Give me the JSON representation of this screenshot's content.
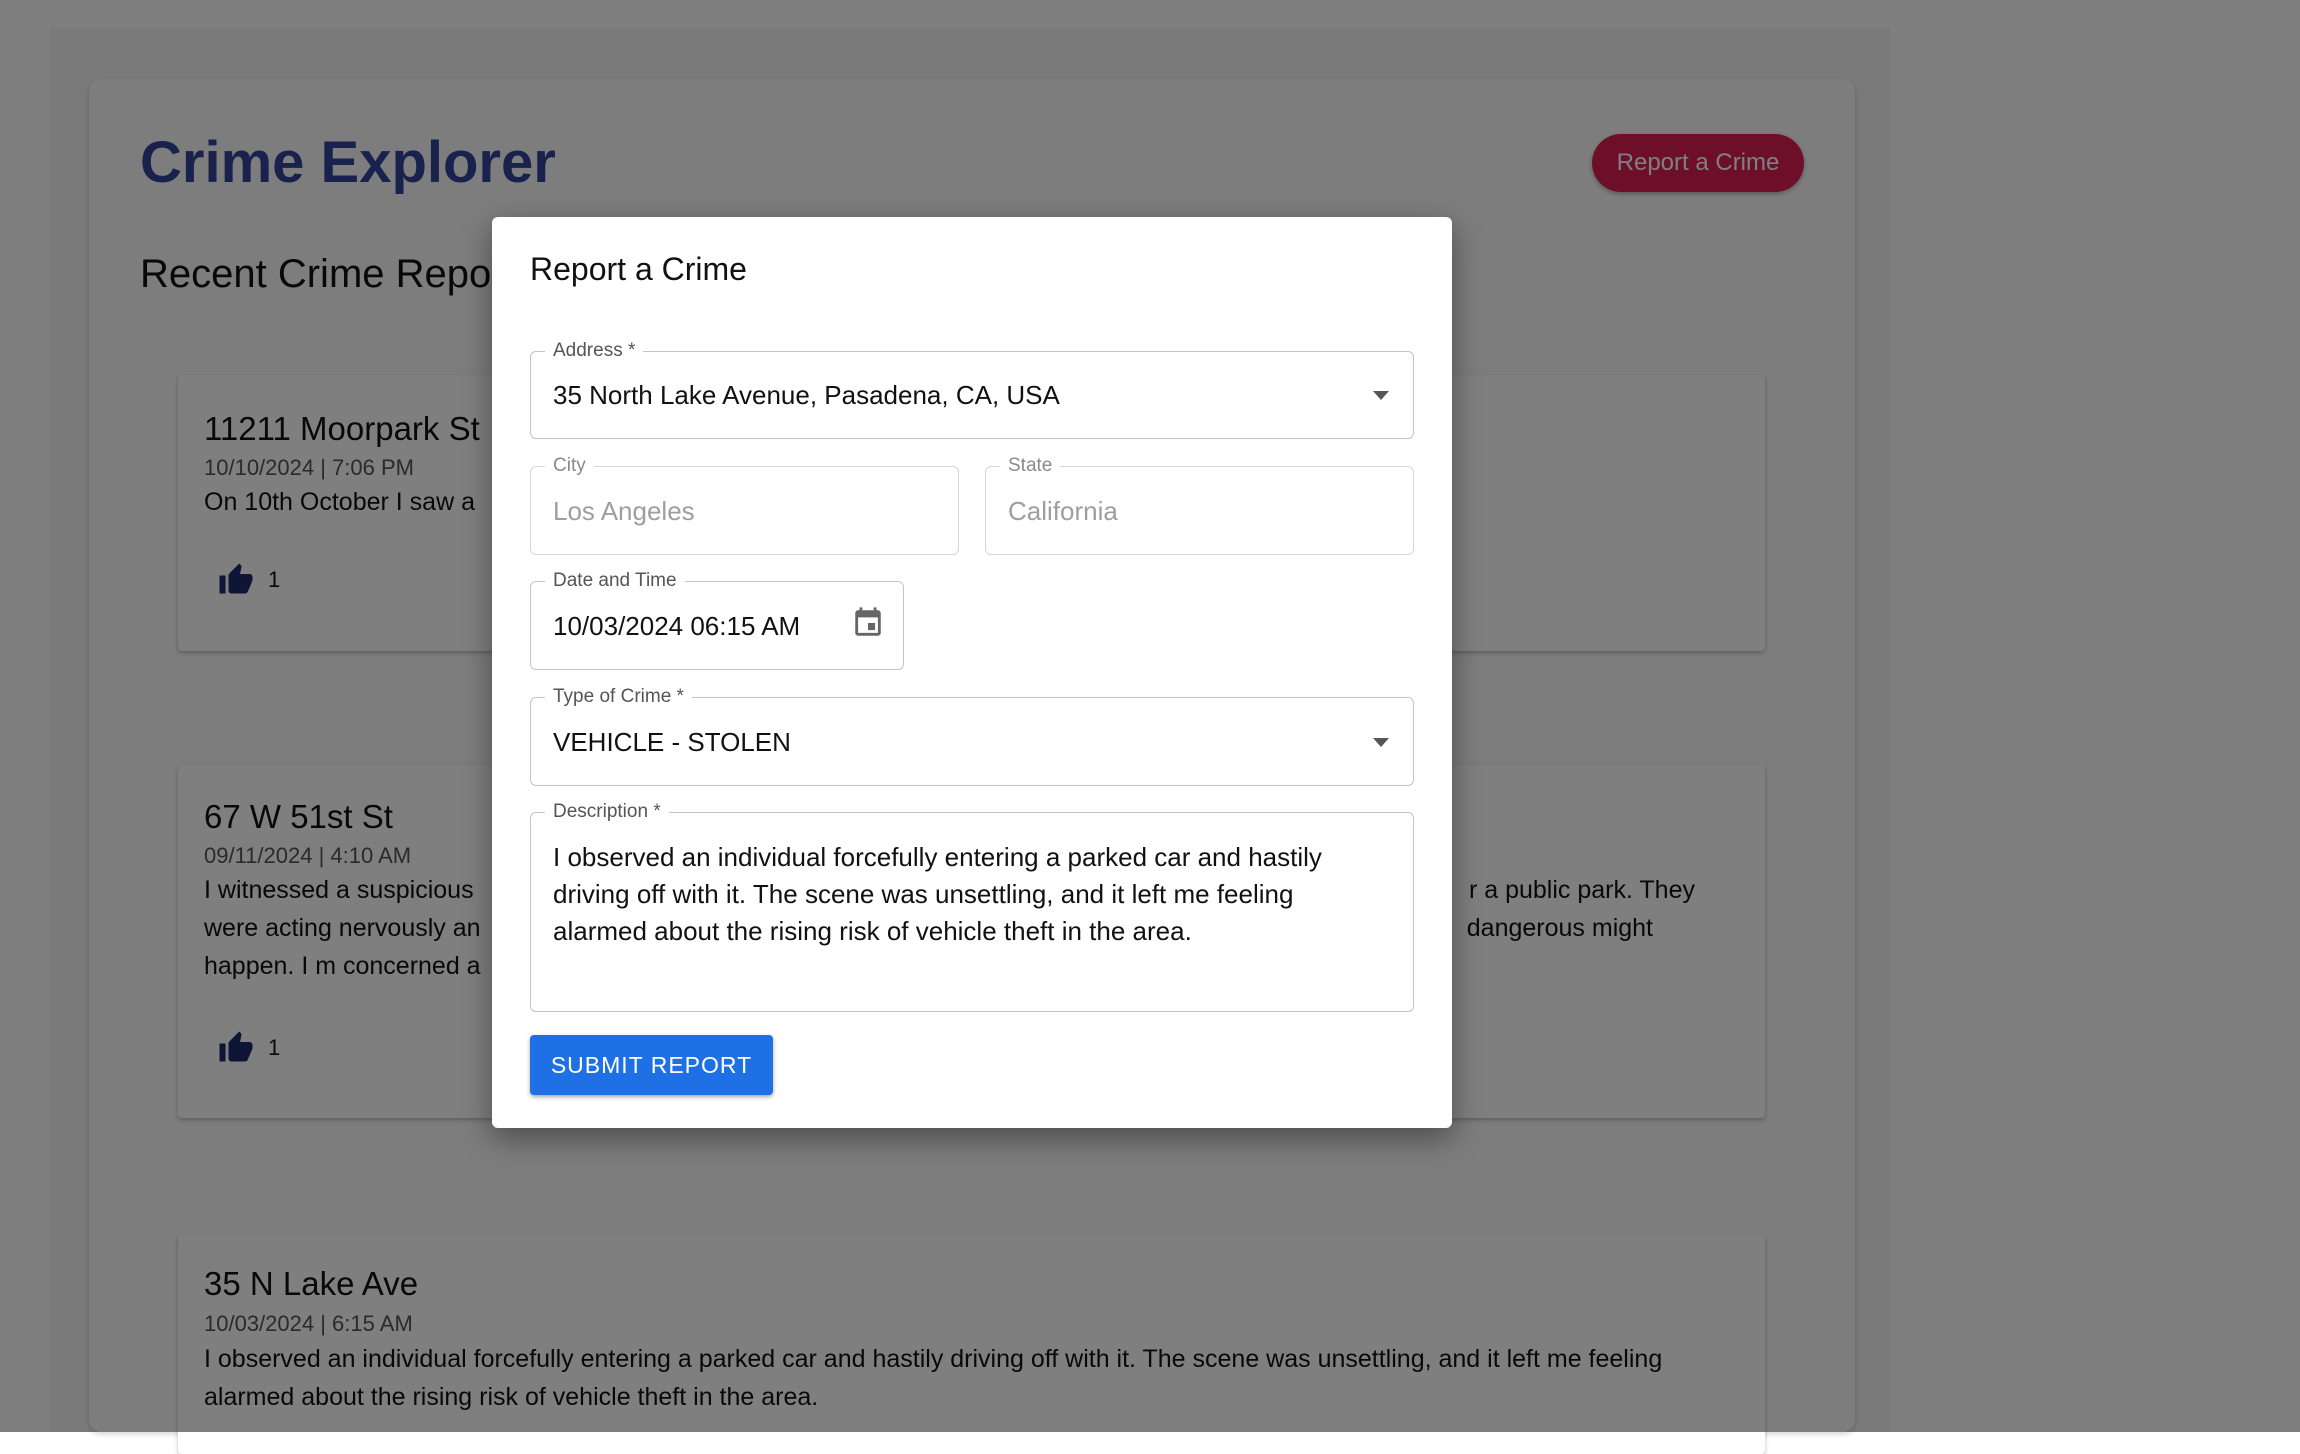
{
  "app": {
    "title": "Crime Explorer",
    "report_button": "Report a Crime"
  },
  "feed": {
    "section_title": "Recent Crime Reports",
    "reports": [
      {
        "address": "11211 Moorpark St",
        "datetime": "10/10/2024 | 7:06 PM",
        "description": "On 10th October I saw a",
        "likes": "1"
      },
      {
        "address": "67 W 51st St",
        "datetime": "09/11/2024 | 4:10 AM",
        "description_lines": [
          {
            "left": "I witnessed a suspicious",
            "right": "r a public park. They"
          },
          {
            "left": "were acting nervously an",
            "right": "dangerous might"
          },
          {
            "left": "happen. I m concerned a",
            "right": ""
          }
        ],
        "likes": "1"
      },
      {
        "address": "35 N Lake Ave",
        "datetime": "10/03/2024 | 6:15 AM",
        "description": "I observed an individual forcefully entering a parked car and hastily driving off with it. The scene was unsettling, and it left me feeling alarmed about the rising risk of vehicle theft in the area."
      }
    ]
  },
  "modal": {
    "title": "Report a Crime",
    "address": {
      "label": "Address *",
      "value": "35 North Lake Avenue, Pasadena, CA, USA"
    },
    "city": {
      "label": "City",
      "value": "Los Angeles"
    },
    "state": {
      "label": "State",
      "value": "California"
    },
    "datetime": {
      "label": "Date and Time",
      "value": "10/03/2024 06:15 AM"
    },
    "crime_type": {
      "label": "Type of Crime *",
      "value": "VEHICLE - STOLEN"
    },
    "description": {
      "label": "Description *",
      "value": "I observed an individual forcefully entering a parked car and hastily driving off with it. The scene was unsettling, and it left me feeling alarmed about the rising risk of vehicle theft in the area."
    },
    "submit_label": "SUBMIT REPORT"
  },
  "colors": {
    "title": "#33429a",
    "accent_button": "#dc1f55",
    "submit_button": "#1f6fe5",
    "thumb_icon": "#1f2a6e",
    "overlay": "rgba(0,0,0,0.5)"
  },
  "icons": {
    "like": "thumb-up-icon",
    "calendar": "calendar-icon",
    "dropdown": "chevron-down-icon"
  }
}
